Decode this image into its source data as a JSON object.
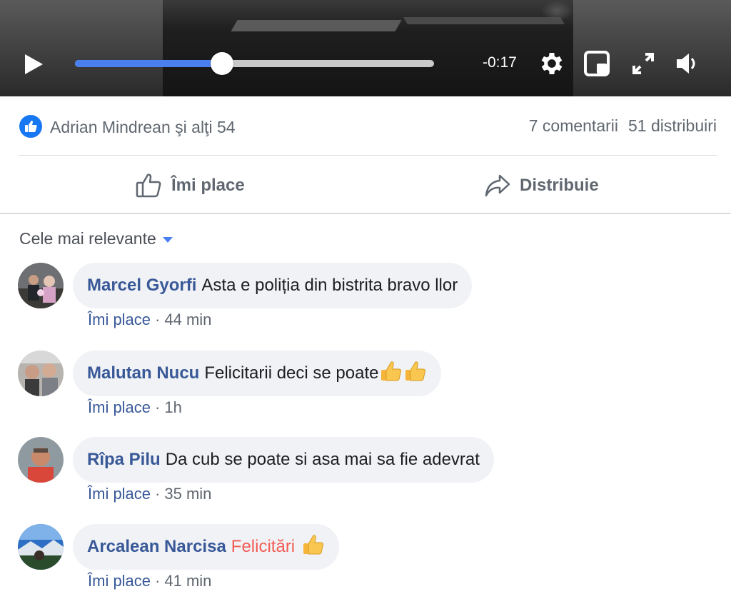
{
  "video": {
    "time_remaining": "-0:17",
    "progress_fraction": 0.41
  },
  "reactions": {
    "summary_text": "Adrian Mindrean şi alţi 54",
    "comments_count": "7 comentarii",
    "shares_count": "51 distribuiri"
  },
  "actions": {
    "like_label": "Îmi place",
    "share_label": "Distribuie"
  },
  "sort": {
    "label": "Cele mai relevante"
  },
  "comments": [
    {
      "author": "Marcel Gyorfi",
      "text": "Asta e poliția din bistrita bravo llor",
      "like_label": "Îmi place",
      "time": "44 min"
    },
    {
      "author": "Malutan Nucu",
      "text": "Felicitarii deci se poate",
      "like_label": "Îmi place",
      "time": "1h"
    },
    {
      "author": "Rîpa Pilu",
      "text": "Da cub se poate si asa mai sa fie adevrat",
      "like_label": "Îmi place",
      "time": "35 min"
    },
    {
      "author": "Arcalean Narcisa",
      "text": "Felicitări",
      "like_label": "Îmi place",
      "time": "41 min"
    }
  ],
  "colors": {
    "accent": "#4a7ff0",
    "author_link": "#385898",
    "highlight_text": "#f25c54",
    "bubble_bg": "#f0f2f5"
  }
}
